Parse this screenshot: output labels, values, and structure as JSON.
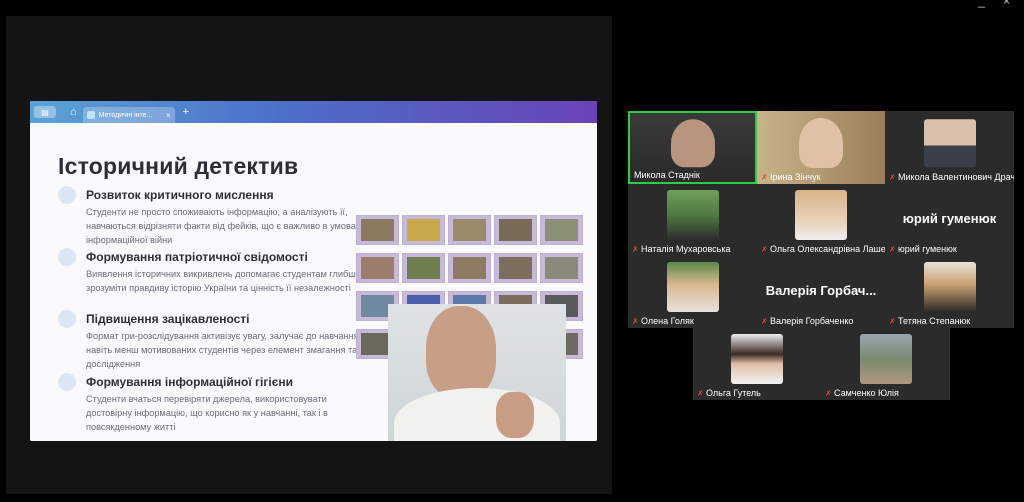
{
  "window_controls": {
    "minimize": "_",
    "close": "×"
  },
  "browser": {
    "tab_title": "Методичні інте...",
    "tab_close": "×",
    "new_tab": "+"
  },
  "slide": {
    "title": "Історичний детектив",
    "points": [
      {
        "title": "Розвиток критичного мислення",
        "text": "Студенти не просто споживають інформацію, а аналізують її, навчаються відрізняти факти від фейків, що є важливо в умовах інформаційної війни"
      },
      {
        "title": "Формування патріотичної свідомості",
        "text": "Виявлення історичних викривлень допомагає студентам глибше зрозуміти правдиву історію України та цінність її незалежності"
      },
      {
        "title": "Підвищення зацікавленості",
        "text": "Формат гри-розслідування активізує увагу, залучає до навчання навіть менш мотивованих студентів через елемент змагання та дослідження"
      },
      {
        "title": "Формування інформаційної гігієни",
        "text": "Студенти вчаться перевіряти джерела, використовувати достовірну інформацію, що корисно як у навчанні, так і в повсякденному житті"
      }
    ]
  },
  "participants": [
    {
      "name": "Микола Стаднік",
      "muted": false,
      "has_video": true,
      "active": true
    },
    {
      "name": "Ірина Зінчук",
      "muted": true,
      "has_video": true
    },
    {
      "name": "Микола Валентинович Драч",
      "muted": true,
      "has_video": true
    },
    {
      "name": "Наталія Мухаровська",
      "muted": true,
      "has_video": true
    },
    {
      "name": "Ольга Олександрівна Лаше...",
      "muted": true,
      "has_video": true
    },
    {
      "name": "юрий гуменюк",
      "muted": true,
      "has_video": false,
      "display": "юрий гуменюк"
    },
    {
      "name": "Олена Голяк",
      "muted": true,
      "has_video": true
    },
    {
      "name": "Валерія Горбаченко",
      "muted": true,
      "has_video": false,
      "display": "Валерія Горбач..."
    },
    {
      "name": "Тетяна Степанюк",
      "muted": true,
      "has_video": true
    },
    {
      "name": "Ольга Гутель",
      "muted": true,
      "has_video": true
    },
    {
      "name": "Самченко Юлія",
      "muted": true,
      "has_video": true
    }
  ],
  "colors": {
    "active_speaker": "#2ecc40",
    "muted_icon": "#e04646"
  }
}
